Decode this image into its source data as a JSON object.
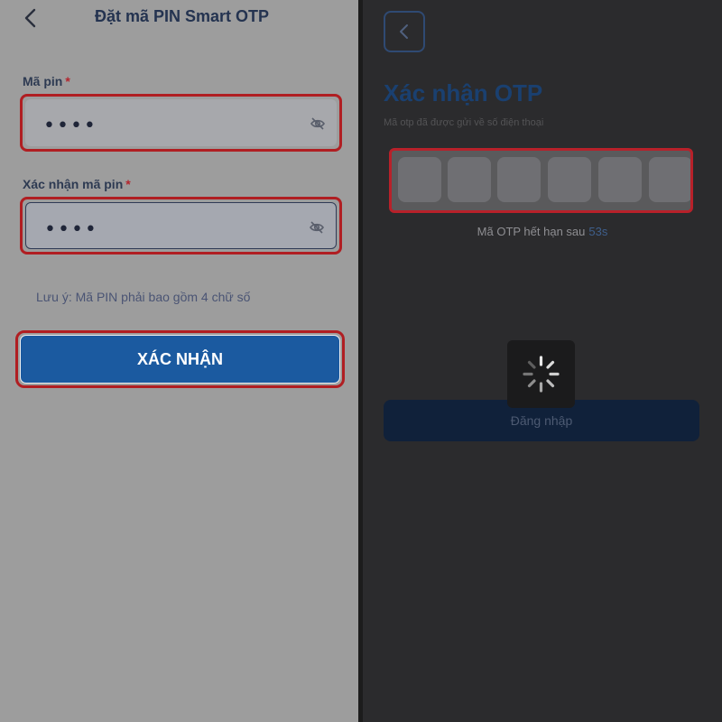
{
  "left": {
    "title": "Đặt mã PIN Smart OTP",
    "back_icon": "chevron-left-icon",
    "pin_label": "Mã pin",
    "pin_value": "••••",
    "confirm_label": "Xác nhận mã pin",
    "confirm_value": "••••",
    "required_mark": "*",
    "eye_icon": "eye-off-icon",
    "note": "Lưu ý: Mã PIN phải bao gồm 4 chữ số",
    "submit_label": "XÁC NHẬN",
    "accent_color": "#1b5aa0",
    "highlight_color": "#b01e22"
  },
  "right": {
    "back_icon": "chevron-left-icon",
    "title": "Xác nhận OTP",
    "subtitle": "Mã otp đã được gửi về số điện thoại",
    "otp_boxes": [
      "",
      "",
      "",
      "",
      "",
      ""
    ],
    "timer_text": "Mã OTP hết hạn sau",
    "timer_seconds": "53s",
    "login_label": "Đăng nhập",
    "spinner_icon": "loading-spinner-icon"
  }
}
